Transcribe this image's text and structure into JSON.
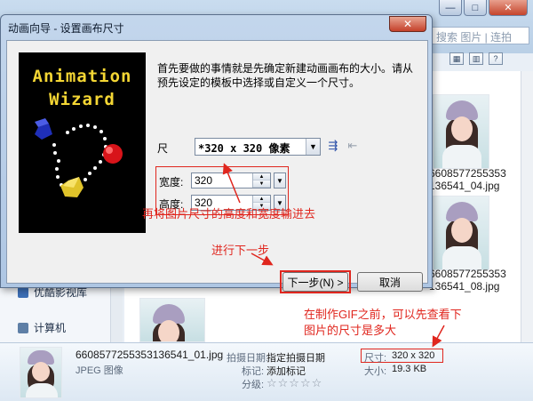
{
  "background": {
    "search_placeholder": "搜索 图片 | 连拍",
    "window_buttons": [
      "—",
      "□",
      "✕"
    ],
    "nav": [
      {
        "label": "优酷影视库",
        "icon": "library-icon"
      },
      {
        "label": "计算机",
        "icon": "computer-icon"
      }
    ],
    "thumbs": [
      {
        "name": "6608577255353136541_04.jpg",
        "line1": "6608577255353",
        "line2": "136541_04.jpg"
      },
      {
        "name": "6608577255353136541_08.jpg",
        "line1": "6608577255353",
        "line2": "136541_08.jpg"
      }
    ]
  },
  "details": {
    "file_name": "6608577255353136541_01.jpg",
    "file_type": "JPEG 图像",
    "date_label": "拍摄日期:",
    "date_value": "指定拍摄日期",
    "tags_label": "标记:",
    "tags_value": "添加标记",
    "rating_label": "分级:",
    "rating_stars": "☆☆☆☆☆",
    "dims_label": "尺寸:",
    "dims_value": "320 x 320",
    "size_label": "大小:",
    "size_value": "19.3 KB"
  },
  "dialog": {
    "title": "动画向导 - 设置画布尺寸",
    "close": "✕",
    "wizard_line1": "Animation",
    "wizard_line2": "Wizard",
    "intro": "首先要做的事情就是先确定新建动画画布的大小。请从预先设定的模板中选择或自定义一个尺寸。",
    "size_label": "尺",
    "size_preset": "*320 x 320 像素",
    "width_label": "宽度:",
    "width_value": "320",
    "height_label": "高度:",
    "height_value": "320",
    "next_button": "下一步(N) >",
    "cancel_button": "取消"
  },
  "annotations": {
    "enter_size": "再将图片尺寸的高度和宽度输进去",
    "go_next": "进行下一步",
    "check_size_line1": "在制作GIF之前，可以先查看下",
    "check_size_line2": "图片的尺寸是多大"
  },
  "colors": {
    "annotation_red": "#e0261e",
    "wizard_yellow": "#f4d634"
  }
}
